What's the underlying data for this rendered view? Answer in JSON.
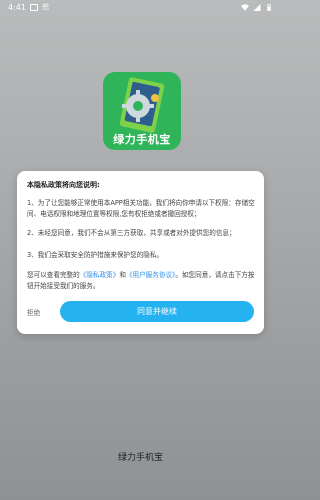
{
  "statusbar": {
    "time": "4:41",
    "left_icon_text": "兜",
    "colors": {
      "text": "#ffffff"
    }
  },
  "app": {
    "name": "绿力手机宝",
    "logo_text": "绿力手机宝"
  },
  "dialog": {
    "title": "本隐私政策将向您说明:",
    "para1": "1、为了让您能够正常使用本APP相关功能，我们将向你申请以下权限：存储空间、电话权限和地理位置等权限,您有权拒绝或者撤回授权；",
    "para2": "2、未经您同意，我们不会从第三方获取，共享或者对外提供您的信息；",
    "para3": "3、我们会采取安全防护措施来保护您的隐私。",
    "para4_prefix": "您可以查看完整的",
    "privacy_link": "《隐私政策》",
    "and_text": "和",
    "service_link": "《用户服务协议》",
    "para4_suffix": "。如您同意，请点击下方按钮开始接受我们的服务。",
    "reject_label": "拒绝",
    "agree_label": "同意并继续",
    "colors": {
      "accent": "#25b2f0",
      "link": "#2d8fe8"
    }
  }
}
